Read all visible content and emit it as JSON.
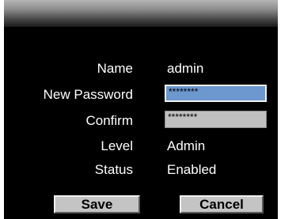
{
  "form": {
    "name": {
      "label": "Name",
      "value": "admin"
    },
    "new_password": {
      "label": "New Password",
      "value": "********"
    },
    "confirm": {
      "label": "Confirm",
      "value": "********"
    },
    "level": {
      "label": "Level",
      "value": "Admin"
    },
    "status": {
      "label": "Status",
      "value": "Enabled"
    }
  },
  "buttons": {
    "save_label": "Save",
    "cancel_label": "Cancel"
  },
  "colors": {
    "background": "#000000",
    "active_field": "#6c97cf",
    "inactive_field": "#c0c0c0",
    "button": "#c4c4c4"
  }
}
